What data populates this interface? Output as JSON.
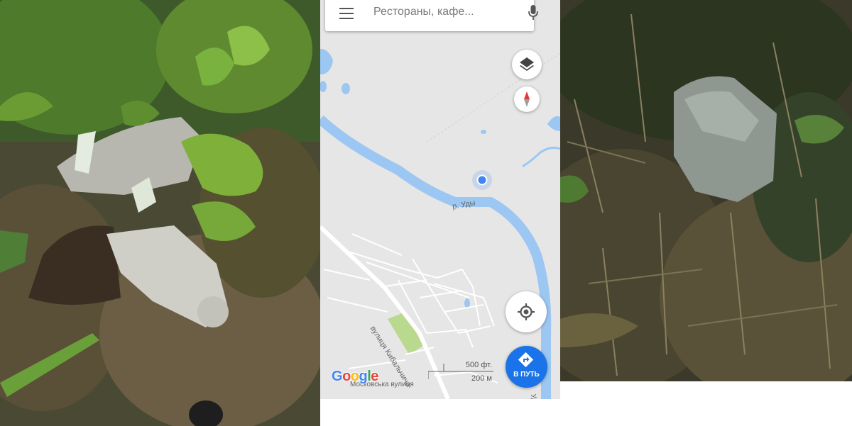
{
  "search": {
    "placeholder": "Рестораны, кафе..."
  },
  "map": {
    "river_label": "р. Уды",
    "street_label_1": "вулиця Кибальчича",
    "street_label_2": "Московська вулиця",
    "river_label_edge": "Уды",
    "scale_imperial": "500 фт.",
    "scale_metric": "200 м",
    "attribution": "Google"
  },
  "buttons": {
    "directions_label": "В ПУТЬ"
  },
  "colors": {
    "water": "#9cc7f2",
    "map_bg": "#e6e6e6",
    "accent": "#1a73e8",
    "location_dot": "#4285f4",
    "compass_red": "#e53935"
  },
  "icons": [
    "menu-icon",
    "microphone-icon",
    "layers-icon",
    "compass-icon",
    "my-location-icon",
    "directions-icon",
    "location-dot-icon"
  ]
}
